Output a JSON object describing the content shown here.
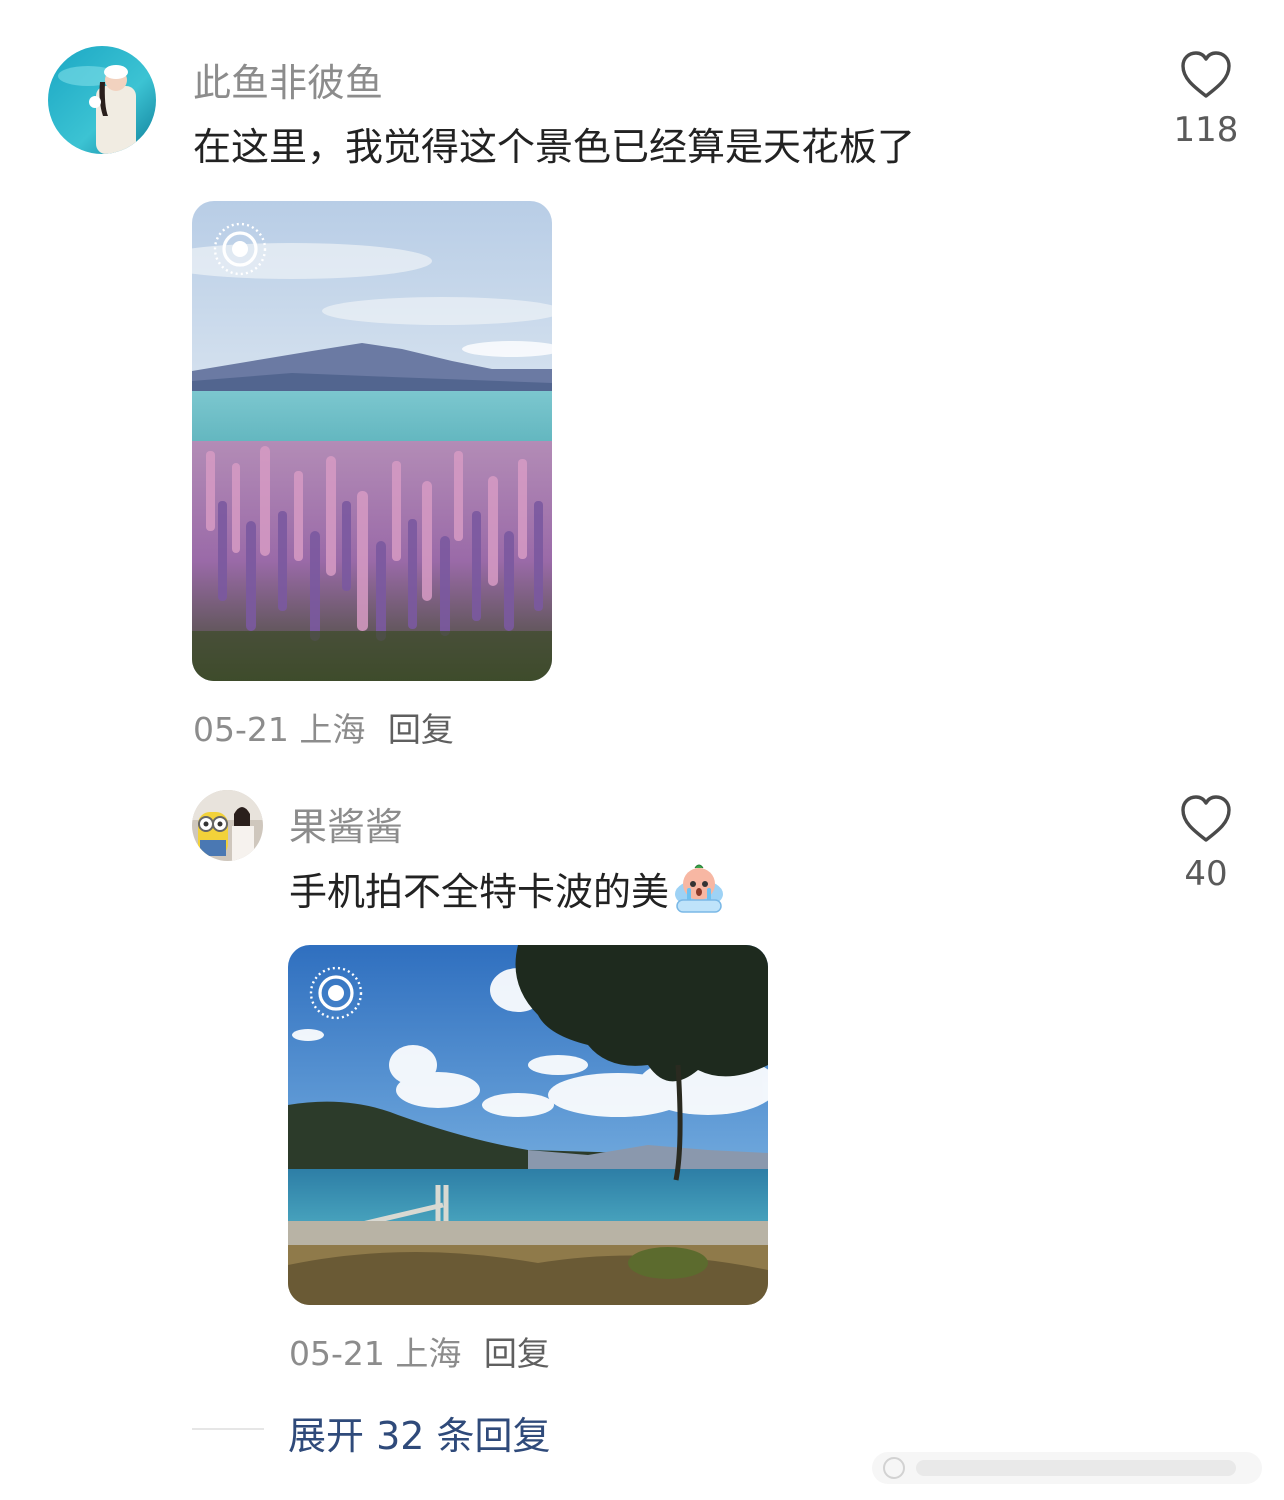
{
  "comments": [
    {
      "username": "此鱼非彼鱼",
      "text": "在这里，我觉得这个景色已经算是天花板了",
      "date": "05-21",
      "location": "上海",
      "reply_label": "回复",
      "likes": "118",
      "photo_icon": "live-photo-icon"
    }
  ],
  "reply": {
    "username": "果酱酱",
    "text": "手机拍不全特卡波的美",
    "emoji": "crying-face-emoji",
    "date": "05-21",
    "location": "上海",
    "reply_label": "回复",
    "likes": "40",
    "photo_icon": "live-photo-icon"
  },
  "expand_label": "展开 32 条回复",
  "colors": {
    "username": "#8c8c8c",
    "expand_link": "#2f4a7a",
    "meta": "#8c8c8c"
  }
}
